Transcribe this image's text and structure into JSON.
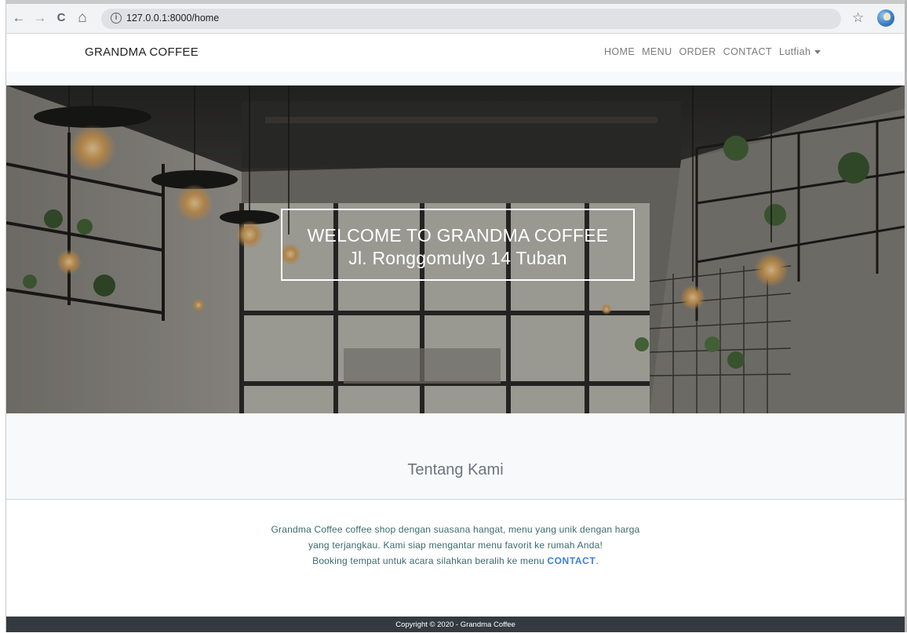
{
  "browser": {
    "url": "127.0.0.1:8000/home",
    "back_icon": "←",
    "forward_icon": "→",
    "reload_icon": "C",
    "home_icon": "⌂",
    "info_icon": "i",
    "star_icon": "☆"
  },
  "navbar": {
    "brand": "GRANDMA COFFEE",
    "links": [
      "HOME",
      "MENU",
      "ORDER",
      "CONTACT"
    ],
    "user": "Lutfiah"
  },
  "hero": {
    "title": "WELCOME TO GRANDMA COFFEE",
    "subtitle": "Jl. Ronggomulyo 14 Tuban"
  },
  "about": {
    "title": "Tentang Kami",
    "line1": "Grandma Coffee coffee shop dengan suasana hangat, menu yang unik dengan harga",
    "line2": "yang terjangkau. Kami siap mengantar menu favorit ke rumah Anda!",
    "line3_prefix": "Booking tempat untuk acara silahkan beralih ke menu ",
    "contact_link": "CONTACT",
    "line3_suffix": "."
  },
  "footer": {
    "copyright": "Copyright © 2020 - Grandma Coffee"
  },
  "colors": {
    "footer_bg": "#343a40",
    "link_accent": "#3b7ddd",
    "about_text": "#3a6b6a",
    "section_bg": "#f8f9fa"
  }
}
